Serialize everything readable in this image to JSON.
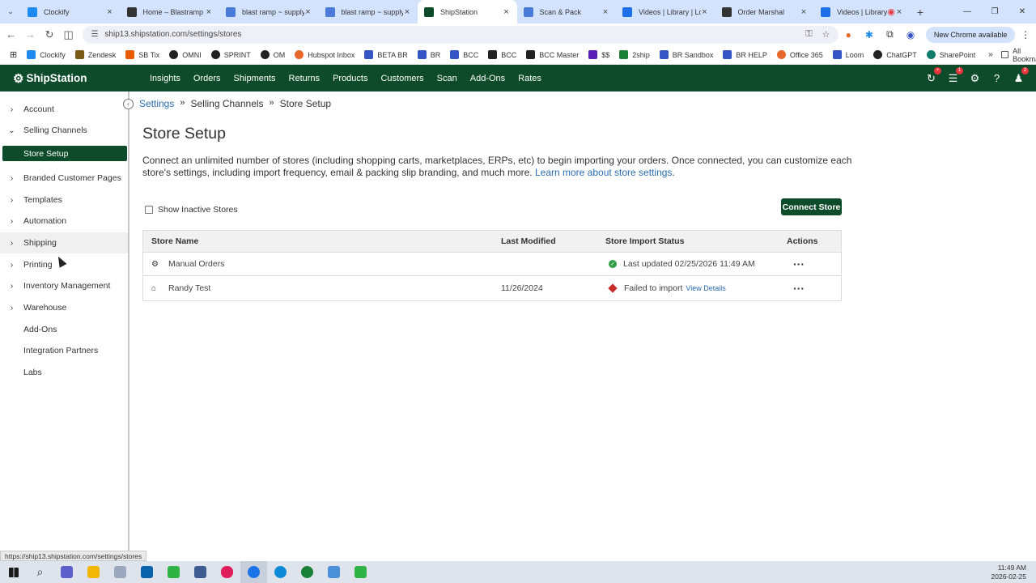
{
  "browser": {
    "tabs": [
      {
        "title": "Clockify",
        "favicon": "#1d8af0",
        "active": false
      },
      {
        "title": "Home – Blastramp He",
        "favicon": "#333333",
        "active": false
      },
      {
        "title": "blast ramp ~ supply c",
        "favicon": "#4a7bd8",
        "active": false
      },
      {
        "title": "blast ramp ~ supply c",
        "favicon": "#4a7bd8",
        "active": false
      },
      {
        "title": "ShipStation",
        "favicon": "#0e4b2a",
        "active": true
      },
      {
        "title": "Scan & Pack",
        "favicon": "#4a7bd8",
        "active": false
      },
      {
        "title": "Videos | Library | Loo",
        "favicon": "#1f6fe8",
        "active": false
      },
      {
        "title": "Order Marshal",
        "favicon": "#333333",
        "active": false
      },
      {
        "title": "Videos | Library |",
        "favicon": "#1f6fe8",
        "active": false
      }
    ],
    "url": "ship13.shipstation.com/settings/stores",
    "chrome_available": "New Chrome available",
    "bookmarks": [
      {
        "label": "Clockify",
        "color": "#1d8af0"
      },
      {
        "label": "Zendesk",
        "color": "#7a5c18"
      },
      {
        "label": "SB Tix",
        "color": "#e85d04"
      },
      {
        "label": "OMNI",
        "color": "#222222"
      },
      {
        "label": "SPRINT",
        "color": "#222222"
      },
      {
        "label": "OM",
        "color": "#222222"
      },
      {
        "label": "Hubspot Inbox",
        "color": "#e8672a"
      },
      {
        "label": "BETA BR",
        "color": "#3555c4"
      },
      {
        "label": "BR",
        "color": "#3555c4"
      },
      {
        "label": "BCC",
        "color": "#3555c4"
      },
      {
        "label": "BCC",
        "color": "#222222"
      },
      {
        "label": "BCC Master",
        "color": "#222222"
      },
      {
        "label": "$$",
        "color": "#5b21b6"
      },
      {
        "label": "2ship",
        "color": "#1a7f37"
      },
      {
        "label": "BR Sandbox",
        "color": "#3555c4"
      },
      {
        "label": "BR HELP",
        "color": "#3555c4"
      },
      {
        "label": "Office 365",
        "color": "#e8672a"
      },
      {
        "label": "Loom",
        "color": "#3555c4"
      },
      {
        "label": "ChatGPT",
        "color": "#222222"
      },
      {
        "label": "SharePoint",
        "color": "#0f7b6c"
      }
    ],
    "all_bookmarks": "All Bookmarks",
    "status_url": "https://ship13.shipstation.com/settings/stores"
  },
  "app": {
    "logo": "ShipStation",
    "nav": [
      "Insights",
      "Orders",
      "Shipments",
      "Returns",
      "Products",
      "Customers",
      "Scan",
      "Add-Ons",
      "Rates"
    ],
    "badges": {
      "refresh": "",
      "orders": "1",
      "account": "2"
    }
  },
  "sidebar": {
    "items": [
      {
        "label": "Account",
        "chevron": "›"
      },
      {
        "label": "Selling Channels",
        "chevron": "⌄"
      },
      {
        "label": "Store Setup",
        "chevron": ""
      },
      {
        "label": "Branded Customer Pages",
        "chevron": "›"
      },
      {
        "label": "Templates",
        "chevron": "›"
      },
      {
        "label": "Automation",
        "chevron": "›"
      },
      {
        "label": "Shipping",
        "chevron": "›"
      },
      {
        "label": "Printing",
        "chevron": "›"
      },
      {
        "label": "Inventory Management",
        "chevron": "›"
      },
      {
        "label": "Warehouse",
        "chevron": "›"
      },
      {
        "label": "Add-Ons",
        "chevron": ""
      },
      {
        "label": "Integration Partners",
        "chevron": ""
      },
      {
        "label": "Labs",
        "chevron": ""
      }
    ]
  },
  "breadcrumb": [
    "Settings",
    "Selling Channels",
    "Store Setup"
  ],
  "page": {
    "title": "Store Setup",
    "description": "Connect an unlimited number of stores (including shopping carts, marketplaces, ERPs, etc) to begin importing your orders. Once connected, you can customize each store's settings, including import frequency, email & packing slip branding, and much more.",
    "learn_more": "Learn more about store settings",
    "show_inactive": "Show Inactive Stores",
    "connect_store": "Connect Store"
  },
  "table": {
    "headers": [
      "Store Name",
      "Last Modified",
      "Store Import Status",
      "Actions"
    ],
    "rows": [
      {
        "name": "Manual Orders",
        "icon": "gear-icon",
        "modified": "",
        "status": "Last updated 02/25/2026 11:49 AM",
        "status_type": "ok",
        "link": ""
      },
      {
        "name": "Randy Test",
        "icon": "store-icon",
        "modified": "11/26/2024",
        "status": "Failed to import",
        "status_type": "error",
        "link": "View Details"
      }
    ]
  },
  "taskbar": {
    "time": "11:49 AM",
    "date": "2026-02-25"
  },
  "colors": {
    "brand": "#0e4b2a",
    "link": "#2b6cb0",
    "error": "#c92a2a",
    "success": "#2f9e44"
  }
}
